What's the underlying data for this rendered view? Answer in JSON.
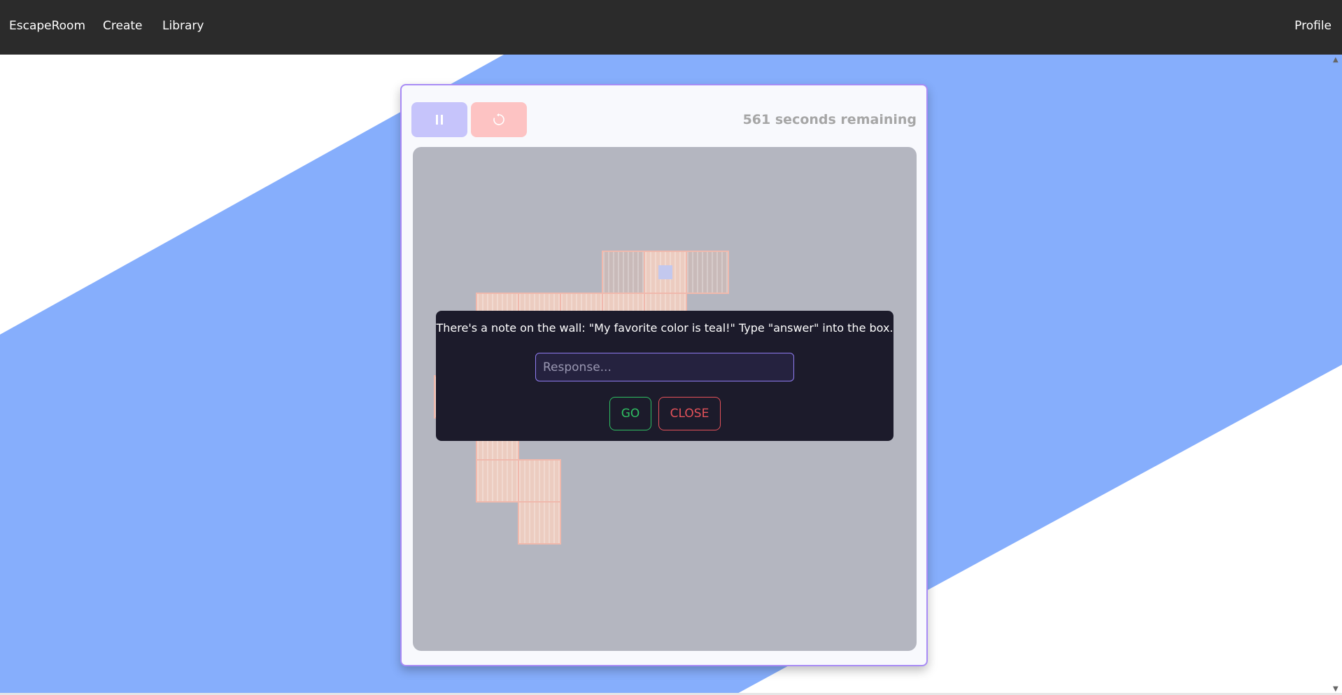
{
  "nav": {
    "brand": "EscapeRoom",
    "items": [
      "Create",
      "Library"
    ],
    "profile": "Profile"
  },
  "game": {
    "timer_value": "561",
    "timer_suffix": "seconds remaining",
    "pause_icon": "pause-icon",
    "restart_icon": "restart-icon"
  },
  "modal": {
    "message": "There's a note on the wall: \"My favorite color is teal!\" Type \"answer\" into the box.",
    "input_placeholder": "Response...",
    "go_label": "GO",
    "close_label": "CLOSE"
  },
  "colors": {
    "navbar": "#2b2b2b",
    "stripe": "#86aefc",
    "card_border": "#a88bf5",
    "board": "#b4b6c0",
    "tile": "#ecccc0",
    "go": "#2fbf62",
    "close": "#e4525a"
  }
}
